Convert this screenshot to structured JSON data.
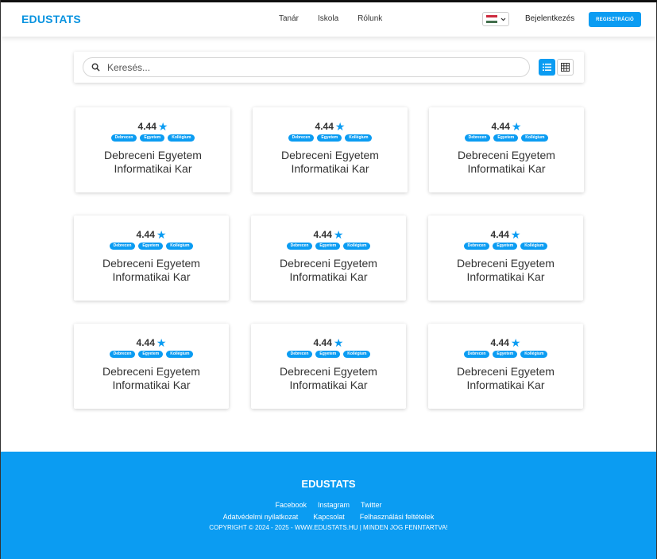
{
  "header": {
    "brand": "EDUSTATS",
    "nav": [
      "Tanár",
      "Iskola",
      "Rólunk"
    ],
    "language_flag": "hu-flag-icon",
    "login_label": "Bejelentkezés",
    "register_label": "REGISZTRÁCIÓ"
  },
  "search": {
    "placeholder": "Keresés...",
    "value": "",
    "icon": "search-icon",
    "view_list_icon": "list-view-icon",
    "view_grid_icon": "grid-view-icon",
    "active_view": "list"
  },
  "cards": [
    {
      "rating": "4.44",
      "tags": [
        "Debrecen",
        "Egyetem",
        "Kollégium"
      ],
      "name_line1": "Debreceni Egyetem",
      "name_line2": "Informatikai Kar"
    },
    {
      "rating": "4.44",
      "tags": [
        "Debrecen",
        "Egyetem",
        "Kollégium"
      ],
      "name_line1": "Debreceni Egyetem",
      "name_line2": "Informatikai Kar"
    },
    {
      "rating": "4.44",
      "tags": [
        "Debrecen",
        "Egyetem",
        "Kollégium"
      ],
      "name_line1": "Debreceni Egyetem",
      "name_line2": "Informatikai Kar"
    },
    {
      "rating": "4.44",
      "tags": [
        "Debrecen",
        "Egyetem",
        "Kollégium"
      ],
      "name_line1": "Debreceni Egyetem",
      "name_line2": "Informatikai Kar"
    },
    {
      "rating": "4.44",
      "tags": [
        "Debrecen",
        "Egyetem",
        "Kollégium"
      ],
      "name_line1": "Debreceni Egyetem",
      "name_line2": "Informatikai Kar"
    },
    {
      "rating": "4.44",
      "tags": [
        "Debrecen",
        "Egyetem",
        "Kollégium"
      ],
      "name_line1": "Debreceni Egyetem",
      "name_line2": "Informatikai Kar"
    },
    {
      "rating": "4.44",
      "tags": [
        "Debrecen",
        "Egyetem",
        "Kollégium"
      ],
      "name_line1": "Debreceni Egyetem",
      "name_line2": "Informatikai Kar"
    },
    {
      "rating": "4.44",
      "tags": [
        "Debrecen",
        "Egyetem",
        "Kollégium"
      ],
      "name_line1": "Debreceni Egyetem",
      "name_line2": "Informatikai Kar"
    },
    {
      "rating": "4.44",
      "tags": [
        "Debrecen",
        "Egyetem",
        "Kollégium"
      ],
      "name_line1": "Debreceni Egyetem",
      "name_line2": "Informatikai Kar"
    }
  ],
  "footer": {
    "brand": "EDUSTATS",
    "social": [
      "Facebook",
      "Instagram",
      "Twitter"
    ],
    "legal": [
      "Adatvédelmi nyilatkozat",
      "Kapcsolat",
      "Felhasználási feltételek"
    ],
    "copyright": "COPYRIGHT © 2024 - 2025 - WWW.EDUSTATS.HU | MINDEN JOG FENNTARTVA!"
  },
  "colors": {
    "accent": "#0b9cf2",
    "brand": "#0b94e0"
  }
}
